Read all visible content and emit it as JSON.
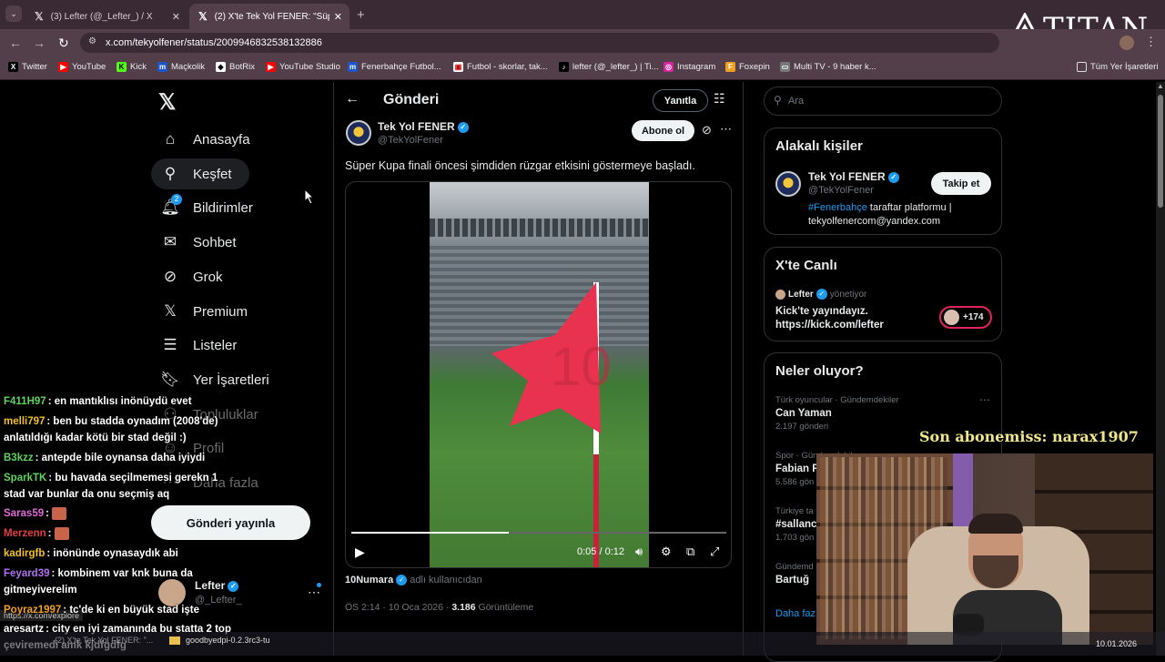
{
  "browser": {
    "tabs": [
      {
        "label": "(3) Lefter (@_Lefter_) / X"
      },
      {
        "label": "(2) X'te Tek Yol FENER: \"Süper K"
      }
    ],
    "url": "x.com/tekyolfener/status/2009946832538132886",
    "bookmarks": [
      "Twitter",
      "YouTube",
      "Kick",
      "Maçkolik",
      "BotRix",
      "YouTube Studio",
      "Fenerbahçe Futbol...",
      "Futbol - skorlar, tak...",
      "lefter (@_lefter_) | Ti...",
      "Instagram",
      "Foxepin",
      "Multi TV - 9 haber k...",
      "Tüm Yer İşaretleri"
    ]
  },
  "overlay_logo": "TITAN",
  "nav": {
    "items": [
      {
        "label": "Anasayfa",
        "icon": "home-icon"
      },
      {
        "label": "Keşfet",
        "icon": "search-icon"
      },
      {
        "label": "Bildirimler",
        "icon": "bell-icon",
        "badge": "2"
      },
      {
        "label": "Sohbet",
        "icon": "mail-icon"
      },
      {
        "label": "Grok",
        "icon": "grok-icon"
      },
      {
        "label": "Premium",
        "icon": "x-logo-icon"
      },
      {
        "label": "Listeler",
        "icon": "list-icon"
      },
      {
        "label": "Yer İşaretleri",
        "icon": "bookmark-icon"
      },
      {
        "label": "Topluluklar",
        "icon": "communities-icon"
      },
      {
        "label": "Profil",
        "icon": "profile-icon"
      },
      {
        "label": "Daha fazla",
        "icon": "more-icon"
      }
    ],
    "post_button": "Gönderi yayınla",
    "account": {
      "name": "Lefter",
      "handle": "@_Lefter_"
    }
  },
  "post": {
    "header_title": "Gönderi",
    "reply_button": "Yanıtla",
    "author_name": "Tek Yol FENER",
    "author_handle": "@TekYolFener",
    "subscribe_button": "Abone ol",
    "text": "Süper Kupa finali öncesi şimdiden rüzgar etkisini göstermeye başladı.",
    "video_time": "0:05 / 0:12",
    "video_progress": 0.42,
    "credit_user": "10Numara",
    "credit_suffix": "adlı kullanıcıdan",
    "timestamp": "ÖS 2:14 · 10 Oca 2026 ·",
    "views_count": "3.186",
    "views_label": "Görüntüleme"
  },
  "status_url": "https://x.com/explore",
  "sidebar": {
    "search_placeholder": "Ara",
    "related": {
      "title": "Alakalı kişiler",
      "name": "Tek Yol FENER",
      "handle": "@TekYolFener",
      "follow_button": "Takip et",
      "bio_hashtag": "#Fenerbahçe",
      "bio_rest": "taraftar platformu |",
      "bio_email": "tekyolfenercom@yandex.com"
    },
    "live": {
      "title": "X'te Canlı",
      "host": "Lefter",
      "role": "yönetiyor",
      "text1": "Kick'te yayındayız.",
      "text2": "https://kick.com/lefter",
      "listeners": "+174"
    },
    "trends": {
      "title": "Neler oluyor?",
      "items": [
        {
          "category": "Türk oyuncular · Gündemdekiler",
          "title": "Can Yaman",
          "count": "2.197 gönderi"
        },
        {
          "category": "Spor · Gündemdekiler",
          "title": "Fabian R",
          "count": "5.586 gön"
        },
        {
          "category": "Türkiye ta",
          "title": "#sallanc",
          "count": "1.703 gön"
        },
        {
          "category": "Gündemd",
          "title": "Bartuğ",
          "count": ""
        }
      ],
      "more": "Daha faz"
    }
  },
  "stream": {
    "sub_banner": "Son abonemiss: narax1907",
    "chat": [
      {
        "nick": "F411H97",
        "color": "#5fd35f",
        "msg": ": en mantıklısı inönüydü evet"
      },
      {
        "nick": "melli797",
        "color": "#f0c020",
        "msg": ": ben bu stadda oynadım (2008'de) anlatıldığı kadar kötü bir stad değil :)"
      },
      {
        "nick": "B3kzz",
        "color": "#5fd35f",
        "msg": ": antepde bile oynansa daha iyiydi"
      },
      {
        "nick": "SparkTK",
        "color": "#5fd35f",
        "msg": ": bu havada seçilmemesi gerekn 1 stad var bunlar da onu seçmiş aq"
      },
      {
        "nick": "Saras59",
        "color": "#e06ad8",
        "msg": ":",
        "emote": true
      },
      {
        "nick": "Merzenn",
        "color": "#e04040",
        "msg": ":",
        "emote": true
      },
      {
        "nick": "kadirgfb",
        "color": "#f0c020",
        "msg": ": inönünde oynasaydık abi"
      },
      {
        "nick": "Feyard39",
        "color": "#b070f0",
        "msg": ": kombinem var knk buna da gitmeyiverelim"
      },
      {
        "nick": "Poyraz1997",
        "color": "#f0a020",
        "msg": ": tc'de ki en büyük stad işte"
      },
      {
        "nick": "aresartz",
        "color": "#ffffff",
        "msg": ": city en iyi zamanında bu statta 2 top çeviremedi amk kjdfgdfg"
      }
    ]
  },
  "taskbar": {
    "item1": "(2) X'te Tek Yol FENER: \"...",
    "item2": "goodbyedpi-0.2.3rc3-tu",
    "date": "10.01.2026"
  }
}
